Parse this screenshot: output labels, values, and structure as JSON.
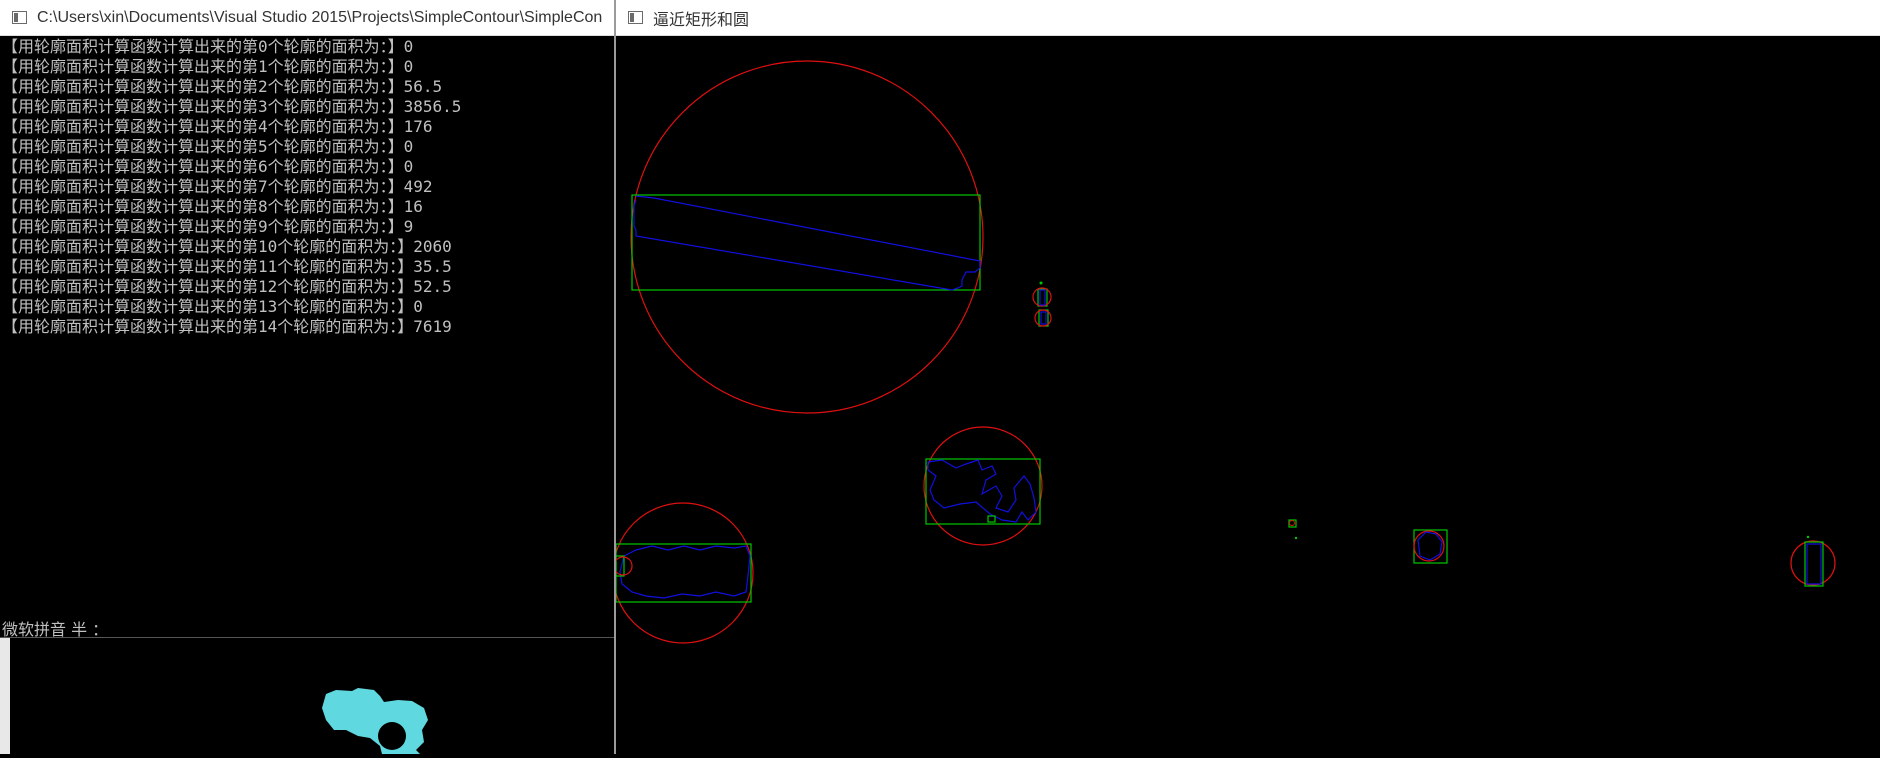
{
  "console": {
    "title": "C:\\Users\\xin\\Documents\\Visual Studio 2015\\Projects\\SimpleContour\\SimpleCon",
    "lines": [
      "【用轮廓面积计算函数计算出来的第0个轮廓的面积为：】0",
      "【用轮廓面积计算函数计算出来的第1个轮廓的面积为：】0",
      "【用轮廓面积计算函数计算出来的第2个轮廓的面积为：】56.5",
      "【用轮廓面积计算函数计算出来的第3个轮廓的面积为：】3856.5",
      "【用轮廓面积计算函数计算出来的第4个轮廓的面积为：】176",
      "【用轮廓面积计算函数计算出来的第5个轮廓的面积为：】0",
      "【用轮廓面积计算函数计算出来的第6个轮廓的面积为：】0",
      "【用轮廓面积计算函数计算出来的第7个轮廓的面积为：】492",
      "【用轮廓面积计算函数计算出来的第8个轮廓的面积为：】16",
      "【用轮廓面积计算函数计算出来的第9个轮廓的面积为：】9",
      "【用轮廓面积计算函数计算出来的第10个轮廓的面积为：】2060",
      "【用轮廓面积计算函数计算出来的第11个轮廓的面积为：】35.5",
      "【用轮廓面积计算函数计算出来的第12个轮廓的面积为：】52.5",
      "【用轮廓面积计算函数计算出来的第13个轮廓的面积为：】0",
      "【用轮廓面积计算函数计算出来的第14个轮廓的面积为：】7619"
    ],
    "ime_status": "微软拼音 半 ：",
    "icon": "console-window-icon"
  },
  "image_window": {
    "title": "逼近矩形和圆",
    "icon": "image-window-icon",
    "colors": {
      "circle": "#e01010",
      "rect": "#00c800",
      "contour": "#1010e0",
      "preview_blob": "#5fd8e0"
    }
  }
}
